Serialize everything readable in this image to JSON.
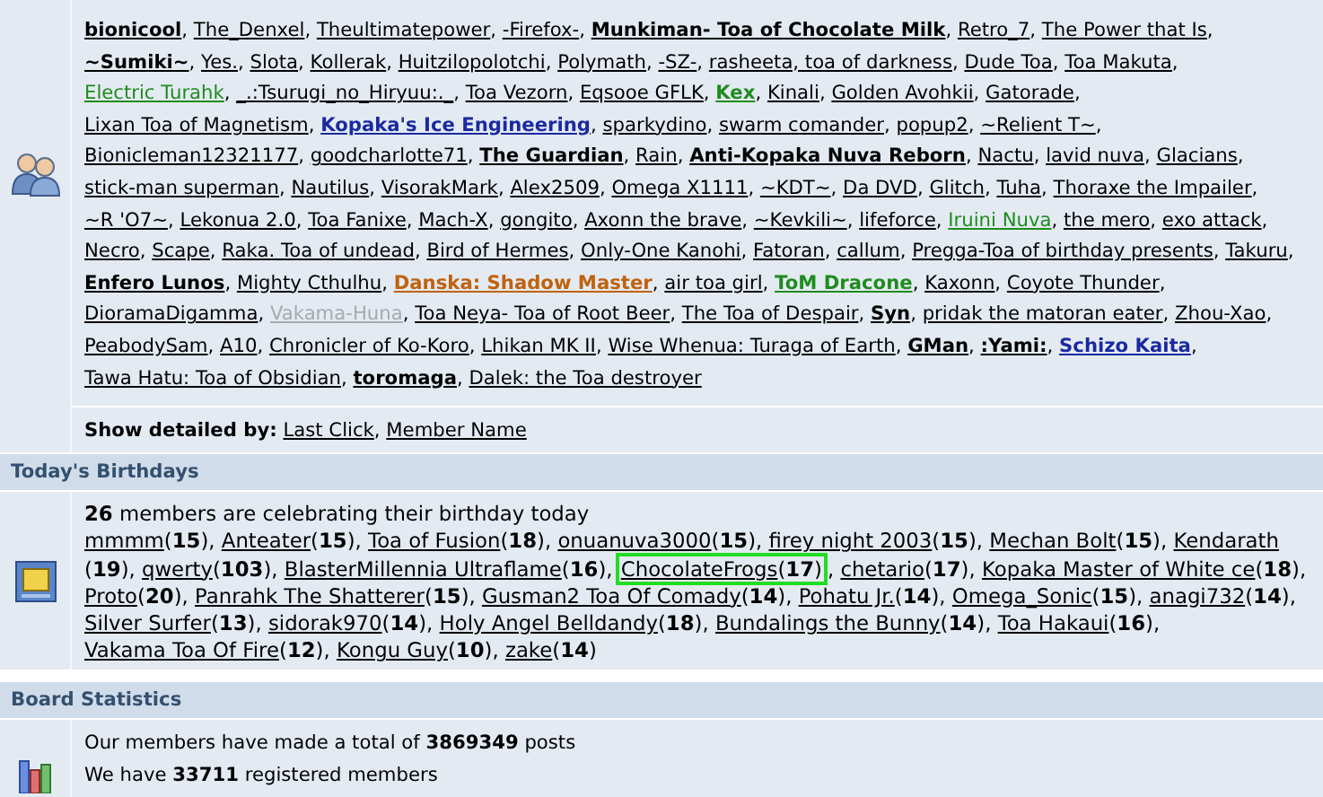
{
  "online": {
    "separator": ",",
    "members": [
      {
        "name": "bionicool",
        "kind": "bold"
      },
      {
        "name": "The_Denxel",
        "kind": "member"
      },
      {
        "name": "Theultimatepower",
        "kind": "member"
      },
      {
        "name": "-Firefox-",
        "kind": "member"
      },
      {
        "name": "Munkiman- Toa of Chocolate Milk",
        "kind": "bold"
      },
      {
        "name": "Retro_7",
        "kind": "member"
      },
      {
        "name": "The Power that Is",
        "kind": "member"
      },
      {
        "name": "~Sumiki~",
        "kind": "bold"
      },
      {
        "name": "Yes.",
        "kind": "member"
      },
      {
        "name": "Slota",
        "kind": "member"
      },
      {
        "name": "Kollerak",
        "kind": "member"
      },
      {
        "name": "Huitzilopolotchi",
        "kind": "member"
      },
      {
        "name": "Polymath",
        "kind": "member"
      },
      {
        "name": "-SZ-",
        "kind": "member"
      },
      {
        "name": "rasheeta, toa of darkness",
        "kind": "member"
      },
      {
        "name": "Dude Toa",
        "kind": "member"
      },
      {
        "name": "Toa Makuta",
        "kind": "member"
      },
      {
        "name": "Electric Turahk",
        "kind": "green"
      },
      {
        "name": "_.:Tsurugi_no_Hiryuu:._",
        "kind": "member"
      },
      {
        "name": "Toa Vezorn",
        "kind": "member"
      },
      {
        "name": "Eqsooe GFLK",
        "kind": "member"
      },
      {
        "name": "Kex",
        "kind": "green-bold"
      },
      {
        "name": "Kinali",
        "kind": "member"
      },
      {
        "name": "Golden Avohkii",
        "kind": "member"
      },
      {
        "name": "Gatorade",
        "kind": "member"
      },
      {
        "name": "Lixan Toa of Magnetism",
        "kind": "member"
      },
      {
        "name": "Kopaka's Ice Engineering",
        "kind": "blue-bold"
      },
      {
        "name": "sparkydino",
        "kind": "member"
      },
      {
        "name": "swarm comander",
        "kind": "member"
      },
      {
        "name": "popup2",
        "kind": "member"
      },
      {
        "name": "~Relient T~",
        "kind": "member"
      },
      {
        "name": "Bionicleman12321177",
        "kind": "member"
      },
      {
        "name": "goodcharlotte71",
        "kind": "member"
      },
      {
        "name": "The Guardian",
        "kind": "bold"
      },
      {
        "name": "Rain",
        "kind": "member"
      },
      {
        "name": "Anti-Kopaka Nuva Reborn",
        "kind": "bold"
      },
      {
        "name": "Nactu",
        "kind": "member"
      },
      {
        "name": "lavid nuva",
        "kind": "member"
      },
      {
        "name": "Glacians",
        "kind": "member"
      },
      {
        "name": "stick-man superman",
        "kind": "member"
      },
      {
        "name": "Nautilus",
        "kind": "member"
      },
      {
        "name": "VisorakMark",
        "kind": "member"
      },
      {
        "name": "Alex2509",
        "kind": "member"
      },
      {
        "name": "Omega X1111",
        "kind": "member"
      },
      {
        "name": "~KDT~",
        "kind": "member"
      },
      {
        "name": "Da DVD",
        "kind": "member"
      },
      {
        "name": "Glitch",
        "kind": "member"
      },
      {
        "name": "Tuha",
        "kind": "member"
      },
      {
        "name": "Thoraxe the Impailer",
        "kind": "member"
      },
      {
        "name": "~R 'O7~",
        "kind": "member"
      },
      {
        "name": "Lekonua 2.0",
        "kind": "member"
      },
      {
        "name": "Toa Fanixe",
        "kind": "member"
      },
      {
        "name": "Mach-X",
        "kind": "member"
      },
      {
        "name": "gongito",
        "kind": "member"
      },
      {
        "name": "Axonn the brave",
        "kind": "member"
      },
      {
        "name": "~Kevkili~",
        "kind": "member"
      },
      {
        "name": "lifeforce",
        "kind": "member"
      },
      {
        "name": "Iruini Nuva",
        "kind": "green"
      },
      {
        "name": "the mero",
        "kind": "member"
      },
      {
        "name": "exo attack",
        "kind": "member"
      },
      {
        "name": "Necro",
        "kind": "member"
      },
      {
        "name": "Scape",
        "kind": "member"
      },
      {
        "name": "Raka. Toa of undead",
        "kind": "member"
      },
      {
        "name": "Bird of Hermes",
        "kind": "member"
      },
      {
        "name": "Only-One Kanohi",
        "kind": "member"
      },
      {
        "name": "Fatoran",
        "kind": "member"
      },
      {
        "name": "callum",
        "kind": "member"
      },
      {
        "name": "Pregga-Toa of birthday presents",
        "kind": "member"
      },
      {
        "name": "Takuru",
        "kind": "member"
      },
      {
        "name": "Enfero Lunos",
        "kind": "bold"
      },
      {
        "name": "Mighty Cthulhu",
        "kind": "member"
      },
      {
        "name": "Danska: Shadow Master",
        "kind": "orange-bold"
      },
      {
        "name": "air toa girl",
        "kind": "member"
      },
      {
        "name": "ToM Dracone",
        "kind": "green-bold"
      },
      {
        "name": "Kaxonn",
        "kind": "member"
      },
      {
        "name": "Coyote Thunder",
        "kind": "member"
      },
      {
        "name": "DioramaDigamma",
        "kind": "member"
      },
      {
        "name": "Vakama-Huna",
        "kind": "faded"
      },
      {
        "name": "Toa Neya- Toa of Root Beer",
        "kind": "member"
      },
      {
        "name": "The Toa of Despair",
        "kind": "member"
      },
      {
        "name": "Syn",
        "kind": "bold"
      },
      {
        "name": "pridak the matoran eater",
        "kind": "member"
      },
      {
        "name": "Zhou-Xao",
        "kind": "member"
      },
      {
        "name": "PeabodySam",
        "kind": "member"
      },
      {
        "name": "A10",
        "kind": "member"
      },
      {
        "name": "Chronicler of Ko-Koro",
        "kind": "member"
      },
      {
        "name": "Lhikan MK II",
        "kind": "member"
      },
      {
        "name": "Wise Whenua: Turaga of Earth",
        "kind": "member"
      },
      {
        "name": "GMan",
        "kind": "bold"
      },
      {
        "name": ":Yami:",
        "kind": "bold"
      },
      {
        "name": "Schizo Kaita",
        "kind": "blue-bold"
      },
      {
        "name": "Tawa Hatu: Toa of Obsidian",
        "kind": "member"
      },
      {
        "name": "toromaga",
        "kind": "bold"
      },
      {
        "name": "Dalek: the Toa destroyer",
        "kind": "member"
      }
    ],
    "detail_label": "Show detailed by:",
    "detail_links": [
      "Last Click",
      "Member Name"
    ]
  },
  "birthdays": {
    "title": "Today's Birthdays",
    "separator": ",",
    "summary": "**26** members are celebrating their birthday today",
    "list": [
      {
        "name": "mmmm",
        "age": "(**15**)",
        "highlighted": false
      },
      {
        "name": "Anteater",
        "age": "(**15**)",
        "highlighted": false
      },
      {
        "name": "Toa of Fusion",
        "age": "(**18**)",
        "highlighted": false
      },
      {
        "name": "onuanuva3000",
        "age": "(**15**)",
        "highlighted": false
      },
      {
        "name": "firey night 2003",
        "age": "(**15**)",
        "highlighted": false
      },
      {
        "name": "Mechan Bolt",
        "age": "(**15**)",
        "highlighted": false
      },
      {
        "name": "Kendarath",
        "age": "(**19**)",
        "highlighted": false
      },
      {
        "name": "qwerty",
        "age": "(**103**)",
        "highlighted": false
      },
      {
        "name": "BlasterMillennia Ultraflame",
        "age": "(**16**)",
        "highlighted": false
      },
      {
        "name": "ChocolateFrogs",
        "age": "(**17**)",
        "highlighted": true
      },
      {
        "name": "chetario",
        "age": "(**17**)",
        "highlighted": false
      },
      {
        "name": "Kopaka Master of White ce",
        "age": "(**18**)",
        "highlighted": false
      },
      {
        "name": "Proto",
        "age": "(**20**)",
        "highlighted": false
      },
      {
        "name": "Panrahk The Shatterer",
        "age": "(**15**)",
        "highlighted": false
      },
      {
        "name": "Gusman2 Toa Of Comady",
        "age": "(**14**)",
        "highlighted": false
      },
      {
        "name": "Pohatu Jr.",
        "age": "(**14**)",
        "highlighted": false
      },
      {
        "name": "Omega_Sonic",
        "age": "(**15**)",
        "highlighted": false
      },
      {
        "name": "anagi732",
        "age": "(**14**)",
        "highlighted": false
      },
      {
        "name": "Silver Surfer",
        "age": "(**13**)",
        "highlighted": false
      },
      {
        "name": "sidorak970",
        "age": "(**14**)",
        "highlighted": false
      },
      {
        "name": "Holy Angel Belldandy",
        "age": "(**18**)",
        "highlighted": false
      },
      {
        "name": "Bundalings the Bunny",
        "age": "(**14**)",
        "highlighted": false
      },
      {
        "name": "Toa Hakaui",
        "age": "(**16**)",
        "highlighted": false
      },
      {
        "name": "Vakama Toa Of Fire",
        "age": "(**12**)",
        "highlighted": false
      },
      {
        "name": "Kongu Guy",
        "age": "(**10**)",
        "highlighted": false
      },
      {
        "name": "zake",
        "age": "(**14**)",
        "highlighted": false
      }
    ]
  },
  "statistics": {
    "title": "Board Statistics",
    "lines": [
      "Our members have made a total of **3869349** posts",
      "We have **33711** registered members"
    ]
  }
}
